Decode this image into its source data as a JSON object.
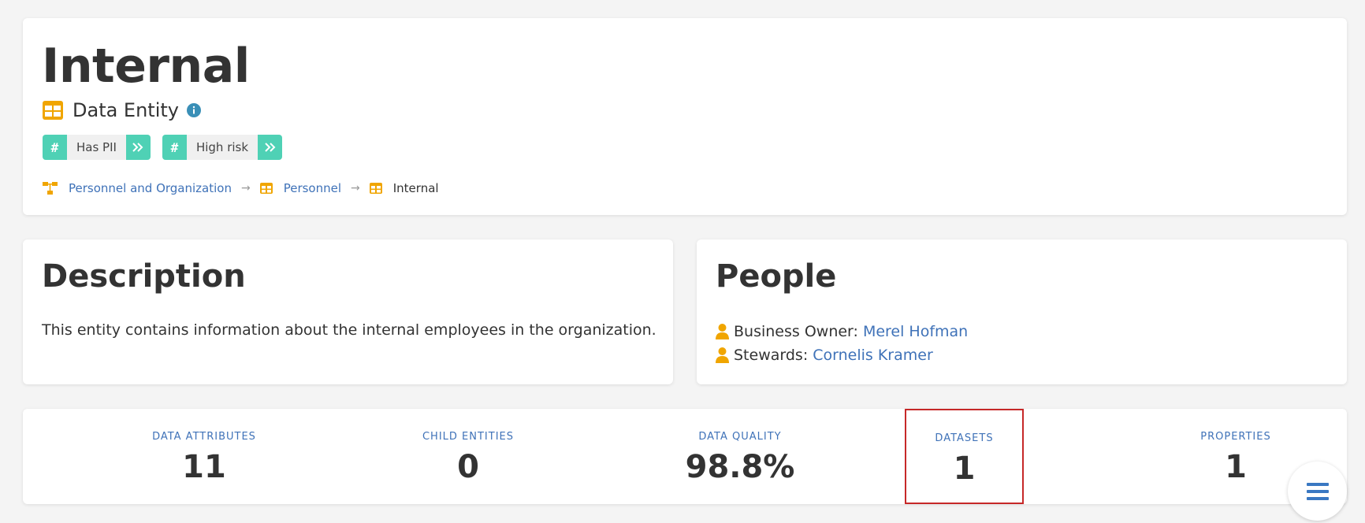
{
  "header": {
    "title": "Internal",
    "type_label": "Data Entity",
    "type_icon": "table-icon",
    "info_icon": "info-icon",
    "tags": [
      {
        "label": "Has PII"
      },
      {
        "label": "High risk"
      }
    ],
    "breadcrumb": [
      {
        "label": "Personnel and Organization",
        "icon": "hierarchy-icon",
        "link": true
      },
      {
        "label": "Personnel",
        "icon": "table-icon",
        "link": true
      },
      {
        "label": "Internal",
        "icon": "table-icon",
        "link": false
      }
    ],
    "breadcrumb_separator": "→"
  },
  "description": {
    "title": "Description",
    "text": "This entity contains information about the internal employees in the organization."
  },
  "people": {
    "title": "People",
    "entries": [
      {
        "role": "Business Owner:",
        "name": "Merel Hofman"
      },
      {
        "role": "Stewards:",
        "name": "Cornelis Kramer"
      }
    ]
  },
  "stats": {
    "attributes": {
      "label": "DATA ATTRIBUTES",
      "value": "11"
    },
    "children": {
      "label": "CHILD ENTITIES",
      "value": "0"
    },
    "quality": {
      "label": "DATA QUALITY",
      "value": "98.8%"
    },
    "datasets": {
      "label": "DATASETS",
      "value": "1"
    },
    "properties": {
      "label": "PROPERTIES",
      "value": "1"
    }
  },
  "colors": {
    "accent_teal": "#4fd1b5",
    "icon_orange": "#f0a500",
    "link_blue": "#3f72b8",
    "highlight_red": "#c62828"
  }
}
